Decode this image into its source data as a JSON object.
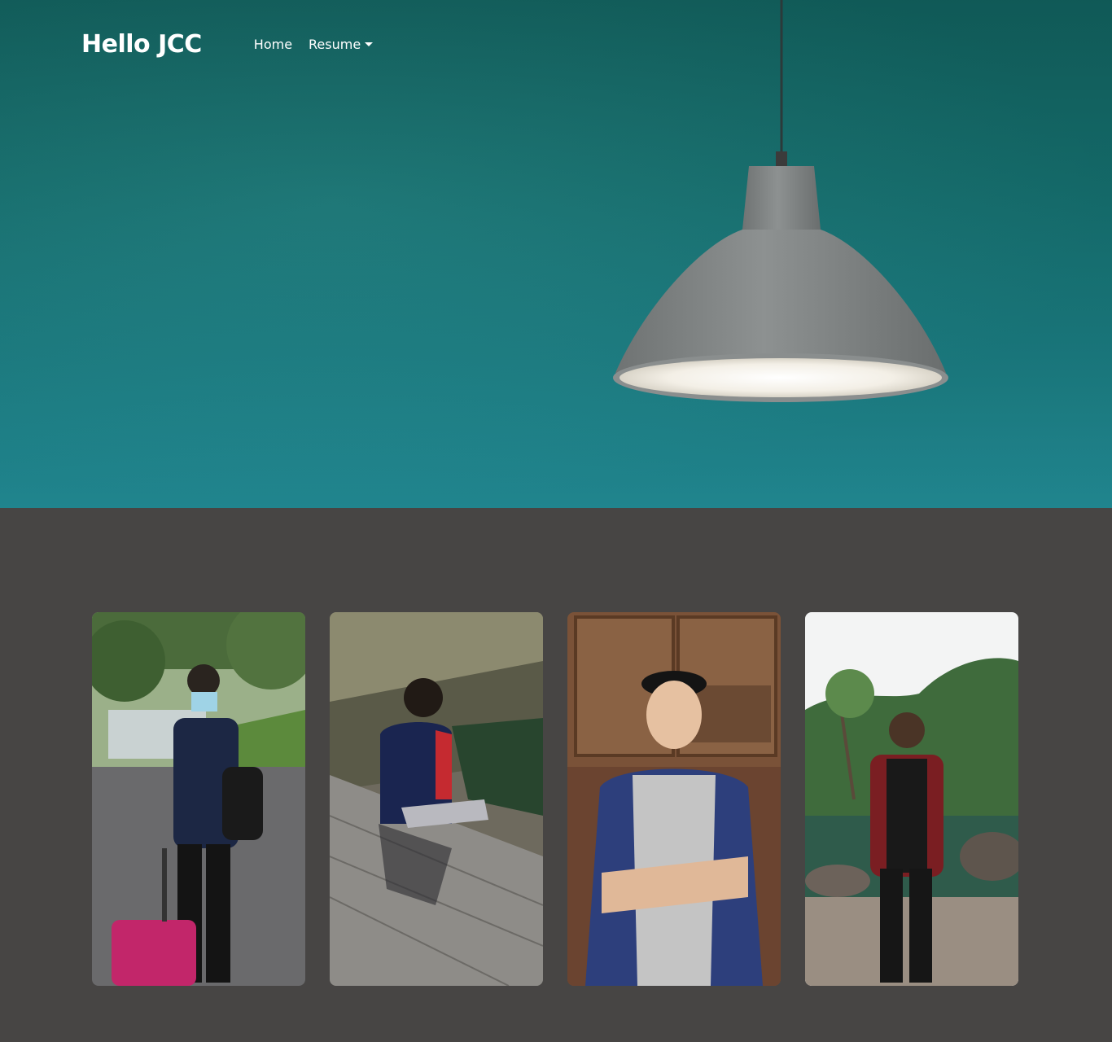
{
  "site": {
    "brand": "Hello JCC"
  },
  "nav": {
    "items": [
      {
        "label": "Home",
        "has_dropdown": false
      },
      {
        "label": "Resume",
        "has_dropdown": true
      }
    ]
  },
  "hero": {
    "background_color": "#15706f",
    "image_subject": "pendant-lamp"
  },
  "gallery": {
    "background_color": "#474544",
    "photos": [
      {
        "subject": "person-with-suitcase"
      },
      {
        "subject": "person-sitting-by-river"
      },
      {
        "subject": "person-arms-crossed"
      },
      {
        "subject": "person-in-park"
      }
    ]
  }
}
